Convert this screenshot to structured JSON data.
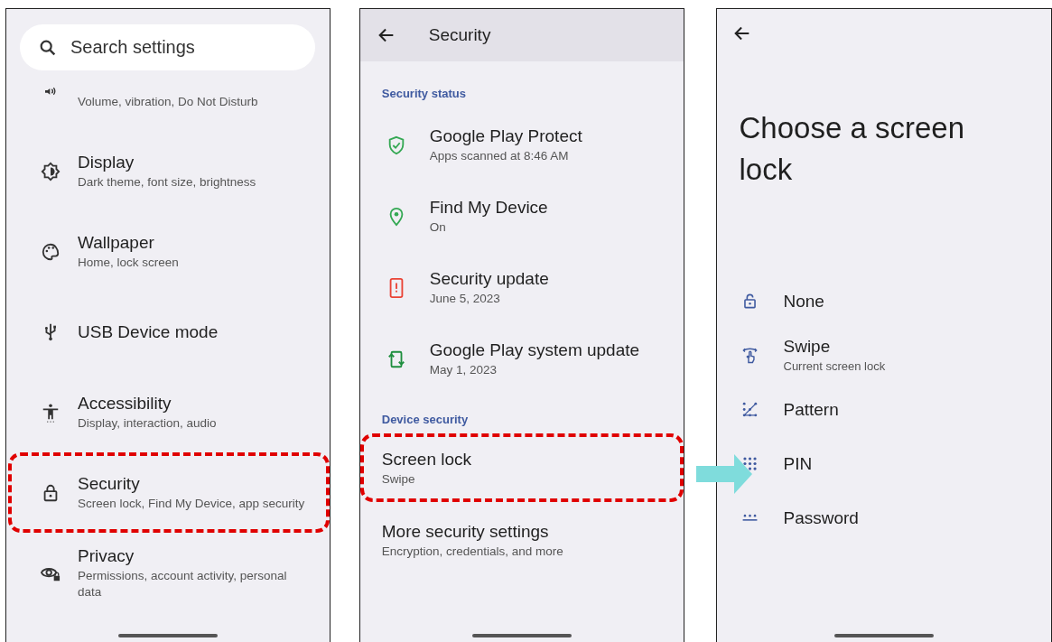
{
  "settings_screen": {
    "search": {
      "placeholder": "Search settings"
    },
    "items": [
      {
        "subtitle": "Volume, vibration, Do Not Disturb",
        "highlighted": false
      },
      {
        "title": "Display",
        "subtitle": "Dark theme, font size, brightness",
        "highlighted": false
      },
      {
        "title": "Wallpaper",
        "subtitle": "Home, lock screen",
        "highlighted": false
      },
      {
        "title": "USB Device mode",
        "highlighted": false
      },
      {
        "title": "Accessibility",
        "subtitle": "Display, interaction, audio",
        "highlighted": false
      },
      {
        "title": "Security",
        "subtitle": "Screen lock, Find My Device, app security",
        "highlighted": true
      },
      {
        "title": "Privacy",
        "subtitle": "Permissions, account activity, personal data",
        "highlighted": false
      }
    ]
  },
  "security_screen": {
    "title": "Security",
    "sections": [
      {
        "heading": "Security status",
        "items": [
          {
            "title": "Google Play Protect",
            "subtitle": "Apps scanned at 8:46 AM",
            "color": "#34a853",
            "highlighted": false
          },
          {
            "title": "Find My Device",
            "subtitle": "On",
            "color": "#34a853",
            "highlighted": false
          },
          {
            "title": "Security update",
            "subtitle": "June 5, 2023",
            "color": "#ea4335",
            "highlighted": false
          },
          {
            "title": "Google Play system update",
            "subtitle": "May 1, 2023",
            "color": "#1e8e3e",
            "highlighted": false
          }
        ]
      },
      {
        "heading": "Device security",
        "items": [
          {
            "title": "Screen lock",
            "subtitle": "Swipe",
            "highlighted": true
          },
          {
            "title": "More security settings",
            "subtitle": "Encryption, credentials, and more",
            "highlighted": false
          }
        ]
      }
    ]
  },
  "lock_screen": {
    "title": "Choose a screen lock",
    "options": [
      {
        "title": "None"
      },
      {
        "title": "Swipe",
        "subtitle": "Current screen lock"
      },
      {
        "title": "Pattern"
      },
      {
        "title": "PIN"
      },
      {
        "title": "Password"
      }
    ]
  }
}
